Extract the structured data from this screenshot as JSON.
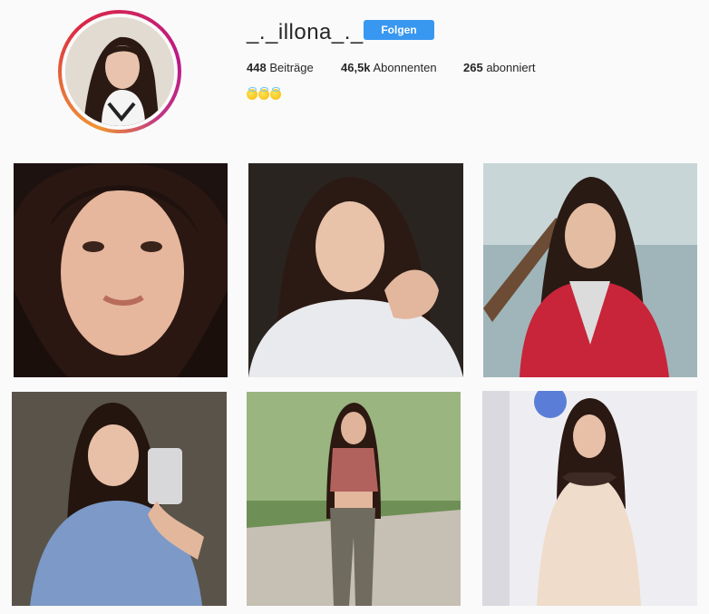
{
  "profile": {
    "username": "_._illona_._",
    "follow_label": "Folgen",
    "stats": {
      "posts_count": "448",
      "posts_label": "Beiträge",
      "followers_count": "46,5k",
      "followers_label": "Abonnenten",
      "following_count": "265",
      "following_label": "abonniert"
    },
    "bio_emoji_icons": [
      "smiling-face-with-halo-icon",
      "smiling-face-with-halo-icon",
      "smiling-face-with-halo-icon"
    ]
  },
  "posts": [
    {
      "subject": "close-up selfie, dark background"
    },
    {
      "subject": "portrait, hand in hair"
    },
    {
      "subject": "selfie, red jacket, staircase"
    },
    {
      "subject": "mirror selfie with phone"
    },
    {
      "subject": "full-length photo in park"
    },
    {
      "subject": "standing in cream dress"
    }
  ],
  "colors": {
    "background": "#fafafa",
    "follow_button": "#3897f0",
    "text": "#262626"
  }
}
